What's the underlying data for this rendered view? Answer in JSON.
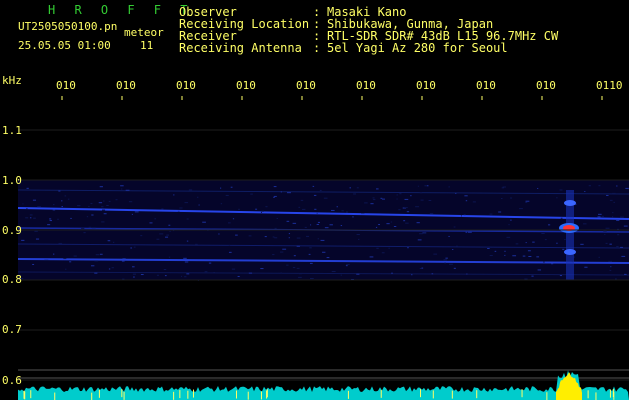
{
  "app": {
    "title": "H R O F F T"
  },
  "file": {
    "name": "UT2505050100.pn",
    "tag": "meteor",
    "date_time": "25.05.05 01:00",
    "count": "11"
  },
  "info": [
    {
      "label": "Observer",
      "sep": ":",
      "value": "Masaki Kano"
    },
    {
      "label": "Receiving Location",
      "sep": ":",
      "value": "Shibukawa, Gunma, Japan"
    },
    {
      "label": "Receiver",
      "sep": ":",
      "value": "RTL-SDR SDR# 43dB L15 96.7MHz CW"
    },
    {
      "label": "Receiving Antenna",
      "sep": ":",
      "value": "5el Yagi Az 280 for Seoul"
    }
  ],
  "axis": {
    "unit": "kHz",
    "y_ticks": [
      "1.1",
      "1.0",
      "0.9",
      "0.8",
      "0.7",
      "0.6"
    ],
    "x_ticks": [
      "010",
      "010",
      "010",
      "010",
      "010",
      "010",
      "010",
      "010",
      "010",
      "0110"
    ]
  },
  "colors": {
    "text": "#ffff66",
    "title": "#33cc33",
    "baseline": "#00ffff",
    "echo": "#ff3333"
  }
}
